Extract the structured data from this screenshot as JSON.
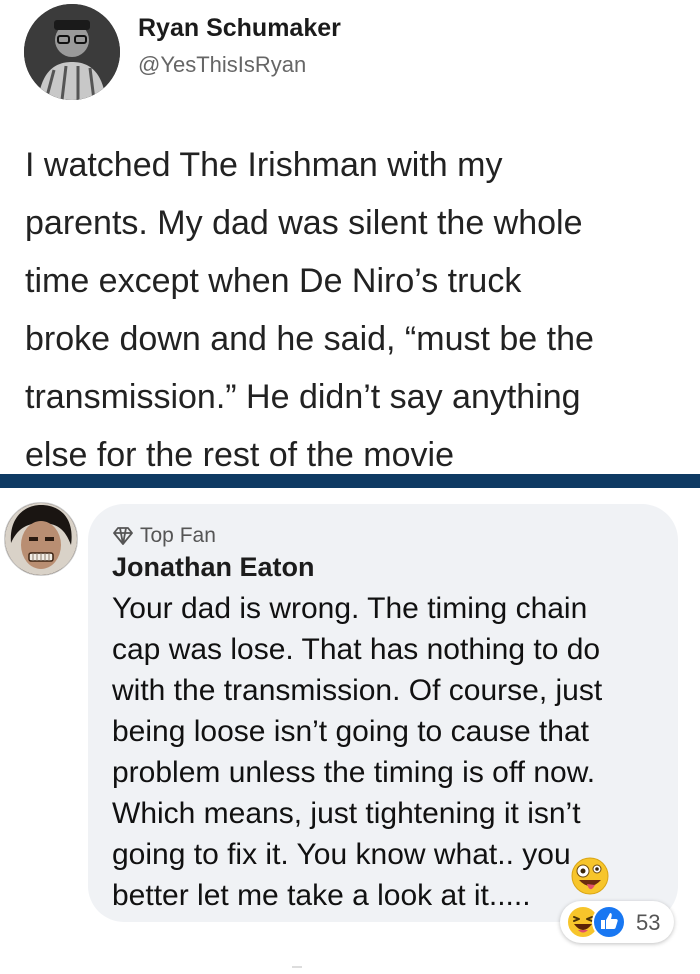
{
  "tweet": {
    "author_name": "Ryan Schumaker",
    "author_handle": "@YesThisIsRyan",
    "text_lines": [
      "I watched The Irishman with my",
      "parents. My dad was silent the whole",
      "time except when De Niro’s truck",
      "broke down and he said, “must be the",
      "transmission.” He didn’t say anything",
      "else for the rest of the movie"
    ]
  },
  "comment": {
    "badge_icon": "diamond-icon",
    "badge_label": "Top Fan",
    "author_name": "Jonathan Eaton",
    "text_lines": [
      "Your dad is wrong. The timing chain",
      "cap was lose. That has nothing to do",
      "with the transmission. Of course, just",
      "being loose isn’t going to cause that",
      "problem unless the timing is off now.",
      "Which means, just tightening it isn’t",
      "going to fix it. You know what.. you",
      "better let me take a look at it....."
    ],
    "inline_emoji": "crazy-face-emoji",
    "reactions": {
      "icons": [
        "haha-reaction-icon",
        "like-reaction-icon"
      ],
      "count": "53"
    }
  },
  "colors": {
    "divider": "#0e3a63",
    "bubble": "#f0f2f5",
    "like_blue": "#1877f2",
    "haha_yellow": "#f7c52b"
  }
}
